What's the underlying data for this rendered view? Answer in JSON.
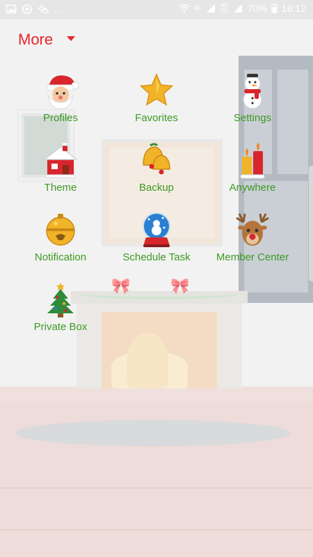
{
  "status_bar": {
    "left_icons": [
      "image-icon",
      "sync-icon",
      "weather-icon"
    ],
    "more_indicator": "...",
    "network_top": "4G",
    "network_a": "4G",
    "network_b": "2G",
    "battery": "70%",
    "time": "16:12"
  },
  "header": {
    "title": "More",
    "accent_color": "#e8252c"
  },
  "menu": {
    "label_color": "#3c9a22",
    "items": [
      {
        "label": "Profiles",
        "icon": "santa-icon"
      },
      {
        "label": "Favorites",
        "icon": "star-icon"
      },
      {
        "label": "Settings",
        "icon": "snowman-icon"
      },
      {
        "label": "Theme",
        "icon": "house-icon"
      },
      {
        "label": "Backup",
        "icon": "bells-icon"
      },
      {
        "label": "Anywhere",
        "icon": "candles-icon"
      },
      {
        "label": "Notification",
        "icon": "jingle-bell-icon"
      },
      {
        "label": "Schedule Task",
        "icon": "snow-globe-icon"
      },
      {
        "label": "Member Center",
        "icon": "reindeer-icon"
      },
      {
        "label": "Private Box",
        "icon": "christmas-tree-icon"
      }
    ]
  }
}
